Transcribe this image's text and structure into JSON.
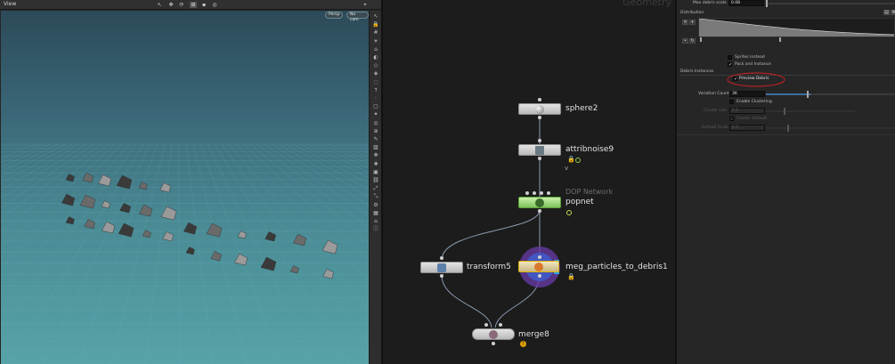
{
  "viewport": {
    "title": "View",
    "camera": "Persp",
    "cam_dropdown": "No cam",
    "toolbar_icons": [
      "select-icon",
      "move-icon",
      "rotate-icon",
      "scale-icon",
      "handle-icon",
      "snap-icon",
      "display-icon"
    ],
    "sidebar_icons": [
      "pointer-icon",
      "lock-icon",
      "grid-icon",
      "lights-icon",
      "camera-icon",
      "shading-icon",
      "wireframe-icon",
      "xray-icon",
      "ghost-icon",
      "normals-icon",
      "points-icon",
      "bbox-icon",
      "light-bulb-icon",
      "target-icon",
      "snap-icon",
      "brush-icon",
      "paint-icon",
      "transform-icon",
      "pivot-icon",
      "fill-icon",
      "link-icon",
      "expand-icon",
      "collapse-icon",
      "settings-icon",
      "layout-icon",
      "home-icon",
      "info-icon"
    ]
  },
  "network": {
    "title": "Geometry",
    "nodes": [
      {
        "name": "sphere2",
        "flag": ""
      },
      {
        "name": "attribnoise9",
        "flag": "v"
      },
      {
        "name": "popnet",
        "sub": "DOP Network"
      },
      {
        "name": "transform5"
      },
      {
        "name": "meg_particles_to_debris1"
      },
      {
        "name": "merge8"
      }
    ]
  },
  "params": {
    "max_debris_scale_label": "Max debris scale",
    "max_debris_scale_value": "0.08",
    "distribution_label": "Distribution",
    "sprites_instead": "Sprites instead",
    "pack_and_instance": "Pack and Instance",
    "debris_instances": "Debris Instances",
    "preview_debris": "Preview Debris",
    "variation_count_label": "Variation Count",
    "variation_count_value": "36",
    "enable_clustering": "Enable Clustering",
    "cluster_size": "Cluster size",
    "cluster_size_value": "0.1",
    "cluster_default": "Cluster Default",
    "default_scale": "Default Scale",
    "default_scale_value": "0.5",
    "accent_color": "#3f6f9e",
    "annotation_color": "#d42020"
  }
}
